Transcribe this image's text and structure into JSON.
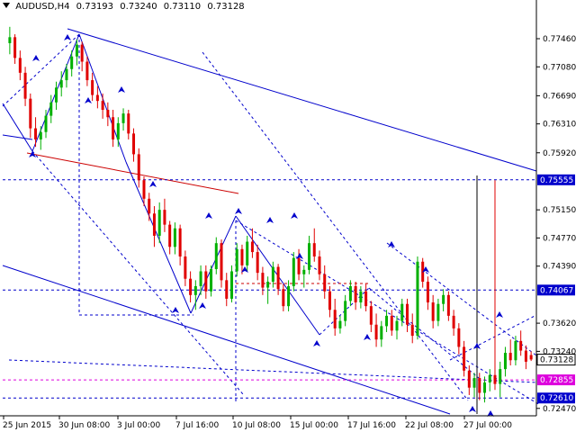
{
  "header": {
    "symbol_tf": "AUDUSD,H4",
    "open": "0.73193",
    "high": "0.73240",
    "low": "0.73110",
    "close": "0.73128"
  },
  "chart_data": {
    "type": "candlestick",
    "symbol": "AUDUSD",
    "timeframe": "H4",
    "ylim": [
      0.7237,
      0.778
    ],
    "price_ticks": [
      {
        "value": 0.7746,
        "label": "0.77460"
      },
      {
        "value": 0.7708,
        "label": "0.77080"
      },
      {
        "value": 0.7669,
        "label": "0.76690"
      },
      {
        "value": 0.7631,
        "label": "0.76310"
      },
      {
        "value": 0.7592,
        "label": "0.75920"
      },
      {
        "value": 0.7515,
        "label": "0.75150"
      },
      {
        "value": 0.7477,
        "label": "0.74770"
      },
      {
        "value": 0.7439,
        "label": "0.74390"
      },
      {
        "value": 0.7362,
        "label": "0.73620"
      },
      {
        "value": 0.7324,
        "label": "0.73240"
      },
      {
        "value": 0.7247,
        "label": "0.72470"
      }
    ],
    "highlighted_levels": [
      {
        "value": 0.75555,
        "label": "0.75555",
        "color": "#0000cc",
        "style": "dashed"
      },
      {
        "value": 0.74067,
        "label": "0.74067",
        "color": "#0000cc",
        "style": "dashed"
      },
      {
        "value": 0.73128,
        "label": "0.73128",
        "color": "#000000",
        "style": "current"
      },
      {
        "value": 0.72855,
        "label": "0.72855",
        "color": "#dd00dd",
        "style": "dashed"
      },
      {
        "value": 0.7261,
        "label": "0.72610",
        "color": "#0000cc",
        "style": "dashed"
      }
    ],
    "time_labels": [
      "25 Jun 2015",
      "30 Jun 08:00",
      "3 Jul 00:00",
      "7 Jul 16:00",
      "10 Jul 08:00",
      "15 Jul 00:00",
      "17 Jul 16:00",
      "22 Jul 08:00",
      "27 Jul 00:00"
    ],
    "candles": [
      [
        0.774,
        0.7762,
        0.7725,
        0.7748
      ],
      [
        0.7748,
        0.7752,
        0.7712,
        0.772
      ],
      [
        0.772,
        0.773,
        0.769,
        0.77
      ],
      [
        0.77,
        0.7708,
        0.7655,
        0.7665
      ],
      [
        0.7665,
        0.7672,
        0.7612,
        0.7625
      ],
      [
        0.7625,
        0.764,
        0.76,
        0.761
      ],
      [
        0.761,
        0.7628,
        0.7596,
        0.762
      ],
      [
        0.762,
        0.765,
        0.7612,
        0.7642
      ],
      [
        0.7642,
        0.767,
        0.7632,
        0.766
      ],
      [
        0.766,
        0.7688,
        0.765,
        0.768
      ],
      [
        0.768,
        0.7702,
        0.7668,
        0.769
      ],
      [
        0.769,
        0.7712,
        0.768,
        0.7705
      ],
      [
        0.7705,
        0.773,
        0.7695,
        0.7722
      ],
      [
        0.7722,
        0.7745,
        0.771,
        0.7738
      ],
      [
        0.7738,
        0.7742,
        0.7702,
        0.7715
      ],
      [
        0.7715,
        0.7722,
        0.7682,
        0.769
      ],
      [
        0.769,
        0.77,
        0.7662,
        0.767
      ],
      [
        0.767,
        0.7682,
        0.7652,
        0.7662
      ],
      [
        0.7662,
        0.7672,
        0.7638,
        0.765
      ],
      [
        0.765,
        0.766,
        0.7628,
        0.764
      ],
      [
        0.764,
        0.765,
        0.76,
        0.761
      ],
      [
        0.761,
        0.764,
        0.76,
        0.7632
      ],
      [
        0.7632,
        0.7652,
        0.7622,
        0.7645
      ],
      [
        0.7645,
        0.765,
        0.761,
        0.7618
      ],
      [
        0.7618,
        0.7625,
        0.758,
        0.759
      ],
      [
        0.759,
        0.7598,
        0.7545,
        0.7555
      ],
      [
        0.7555,
        0.756,
        0.752,
        0.753
      ],
      [
        0.753,
        0.7538,
        0.75,
        0.751
      ],
      [
        0.751,
        0.752,
        0.7465,
        0.748
      ],
      [
        0.748,
        0.7525,
        0.747,
        0.7515
      ],
      [
        0.7515,
        0.753,
        0.7485,
        0.7495
      ],
      [
        0.7495,
        0.75,
        0.7455,
        0.7465
      ],
      [
        0.7465,
        0.7498,
        0.7455,
        0.749
      ],
      [
        0.749,
        0.7495,
        0.744,
        0.7452
      ],
      [
        0.7452,
        0.746,
        0.7412,
        0.7422
      ],
      [
        0.7422,
        0.7432,
        0.739,
        0.74
      ],
      [
        0.74,
        0.742,
        0.738,
        0.7412
      ],
      [
        0.7412,
        0.744,
        0.74,
        0.7432
      ],
      [
        0.7432,
        0.744,
        0.7395,
        0.7405
      ],
      [
        0.7405,
        0.744,
        0.7398,
        0.7435
      ],
      [
        0.7435,
        0.7478,
        0.7428,
        0.747
      ],
      [
        0.747,
        0.7475,
        0.741,
        0.742
      ],
      [
        0.742,
        0.743,
        0.7385,
        0.7395
      ],
      [
        0.7395,
        0.744,
        0.739,
        0.7432
      ],
      [
        0.7432,
        0.747,
        0.7425,
        0.7462
      ],
      [
        0.7462,
        0.7468,
        0.7428,
        0.744
      ],
      [
        0.744,
        0.748,
        0.7432,
        0.7472
      ],
      [
        0.7472,
        0.749,
        0.745,
        0.7458
      ],
      [
        0.7458,
        0.7468,
        0.742,
        0.743
      ],
      [
        0.743,
        0.7438,
        0.74,
        0.741
      ],
      [
        0.741,
        0.7425,
        0.7388,
        0.7418
      ],
      [
        0.7418,
        0.7445,
        0.741,
        0.7438
      ],
      [
        0.7438,
        0.7442,
        0.74,
        0.7408
      ],
      [
        0.7408,
        0.7415,
        0.7378,
        0.7385
      ],
      [
        0.7385,
        0.742,
        0.7378,
        0.7412
      ],
      [
        0.7412,
        0.7458,
        0.7405,
        0.745
      ],
      [
        0.745,
        0.7462,
        0.742,
        0.7428
      ],
      [
        0.7428,
        0.744,
        0.741,
        0.7434
      ],
      [
        0.7434,
        0.748,
        0.7428,
        0.747
      ],
      [
        0.747,
        0.749,
        0.7445,
        0.7452
      ],
      [
        0.7452,
        0.746,
        0.742,
        0.7428
      ],
      [
        0.7428,
        0.744,
        0.7395,
        0.7405
      ],
      [
        0.7405,
        0.7412,
        0.737,
        0.738
      ],
      [
        0.738,
        0.7395,
        0.7345,
        0.7355
      ],
      [
        0.7355,
        0.7372,
        0.7348,
        0.7365
      ],
      [
        0.7365,
        0.74,
        0.7358,
        0.7392
      ],
      [
        0.7392,
        0.742,
        0.7385,
        0.7412
      ],
      [
        0.7412,
        0.7418,
        0.738,
        0.739
      ],
      [
        0.739,
        0.7412,
        0.7382,
        0.7405
      ],
      [
        0.7405,
        0.7415,
        0.7378,
        0.7385
      ],
      [
        0.7385,
        0.7392,
        0.735,
        0.736
      ],
      [
        0.736,
        0.7375,
        0.733,
        0.734
      ],
      [
        0.734,
        0.7365,
        0.733,
        0.7358
      ],
      [
        0.7358,
        0.738,
        0.735,
        0.7372
      ],
      [
        0.7372,
        0.738,
        0.7345,
        0.7352
      ],
      [
        0.7352,
        0.7372,
        0.734,
        0.7365
      ],
      [
        0.7365,
        0.7395,
        0.7358,
        0.7388
      ],
      [
        0.7388,
        0.7395,
        0.735,
        0.736
      ],
      [
        0.736,
        0.7375,
        0.7335,
        0.7345
      ],
      [
        0.7345,
        0.7452,
        0.734,
        0.7445
      ],
      [
        0.7445,
        0.745,
        0.741,
        0.7418
      ],
      [
        0.7418,
        0.7425,
        0.738,
        0.739
      ],
      [
        0.739,
        0.74,
        0.7355,
        0.7365
      ],
      [
        0.7365,
        0.7395,
        0.7358,
        0.7388
      ],
      [
        0.7388,
        0.7408,
        0.7378,
        0.74
      ],
      [
        0.74,
        0.7405,
        0.7365,
        0.7372
      ],
      [
        0.7372,
        0.738,
        0.7345,
        0.7355
      ],
      [
        0.7355,
        0.7362,
        0.732,
        0.733
      ],
      [
        0.733,
        0.7338,
        0.729,
        0.7298
      ],
      [
        0.7298,
        0.7305,
        0.7265,
        0.7275
      ],
      [
        0.7275,
        0.7295,
        0.7262,
        0.7288
      ],
      [
        0.7288,
        0.7295,
        0.7258,
        0.7268
      ],
      [
        0.7268,
        0.729,
        0.7255,
        0.7282
      ],
      [
        0.7282,
        0.73,
        0.727,
        0.7292
      ],
      [
        0.7292,
        0.7555,
        0.7272,
        0.728
      ],
      [
        0.728,
        0.731,
        0.7262,
        0.73
      ],
      [
        0.73,
        0.733,
        0.729,
        0.7322
      ],
      [
        0.7322,
        0.734,
        0.7305,
        0.7312
      ],
      [
        0.7312,
        0.7345,
        0.7305,
        0.7338
      ],
      [
        0.7338,
        0.7352,
        0.7318,
        0.7325
      ],
      [
        0.7325,
        0.7332,
        0.73,
        0.731
      ],
      [
        0.7319,
        0.7324,
        0.7311,
        0.7313
      ]
    ]
  },
  "colors": {
    "bull": "#00b000",
    "bear": "#e00000",
    "wave": "#0000cc",
    "red_line": "#cc0000",
    "magenta": "#dd00dd",
    "axis": "#000000"
  },
  "icons": [
    "wave-arrow-icon",
    "dropdown-triangle-icon"
  ]
}
